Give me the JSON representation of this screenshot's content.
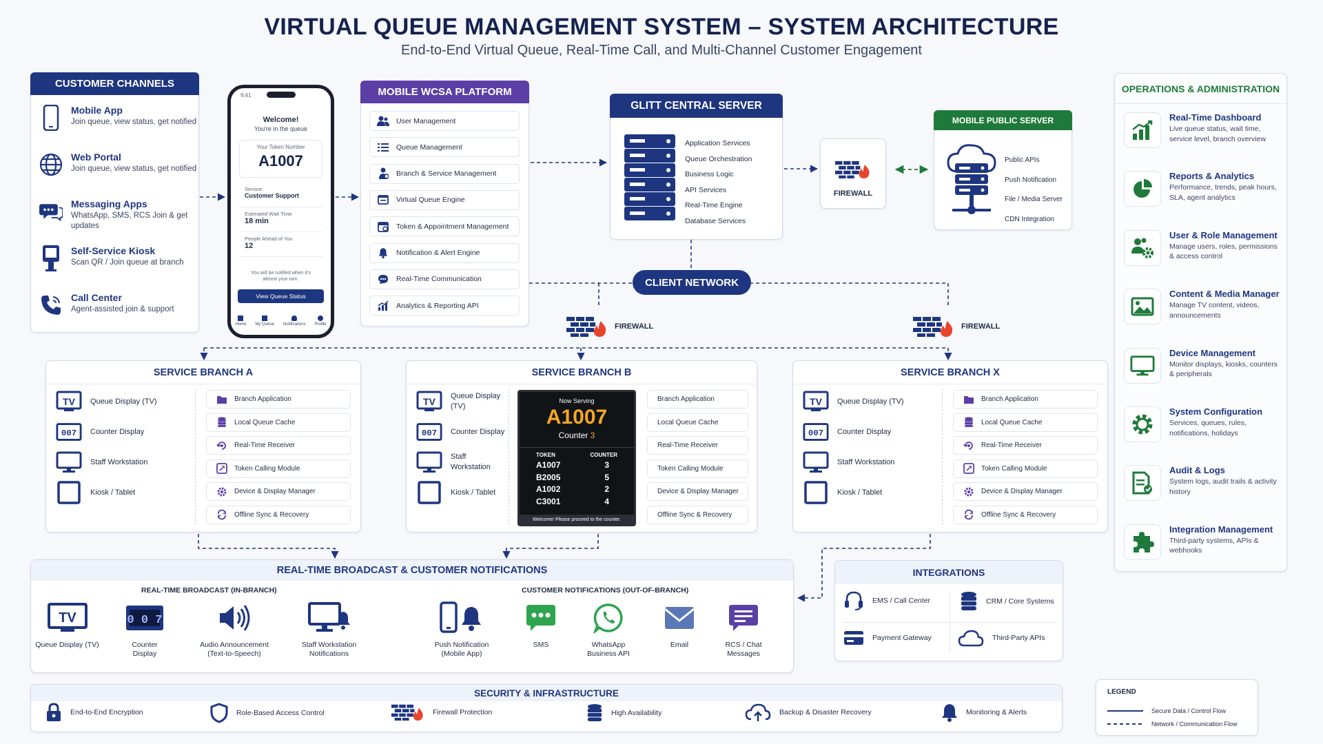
{
  "title": "VIRTUAL QUEUE MANAGEMENT SYSTEM – SYSTEM ARCHITECTURE",
  "subtitle": "End-to-End Virtual Queue, Real-Time Call, and Multi-Channel Customer Engagement",
  "colors": {
    "navy": "#1e3680",
    "purple": "#5b3fa6",
    "green": "#1e7a3a",
    "fire": "#e8452c"
  },
  "channels": {
    "header": "CUSTOMER CHANNELS",
    "items": [
      {
        "title": "Mobile App",
        "desc": "Join queue, view status, get notified",
        "icon": "mobile-icon"
      },
      {
        "title": "Web Portal",
        "desc": "Join queue, view status, get notified",
        "icon": "globe-icon"
      },
      {
        "title": "Messaging Apps",
        "desc": "WhatsApp, SMS, RCS Join & get updates",
        "icon": "chat-icon"
      },
      {
        "title": "Self-Service Kiosk",
        "desc": "Scan QR / Join queue at branch",
        "icon": "kiosk-icon"
      },
      {
        "title": "Call Center",
        "desc": "Agent-assisted join & support",
        "icon": "phone-icon"
      }
    ]
  },
  "phone": {
    "time": "9:41",
    "welcome": "Welcome!",
    "in_queue": "You're in the queue",
    "token_label": "Your Token Number",
    "token": "A1007",
    "service_label": "Service",
    "service": "Customer Support",
    "wait_label": "Estimated Wait Time",
    "wait": "18 min",
    "ahead_label": "People Ahead of You",
    "ahead": "12",
    "notify": "You will be notified when it's almost your turn.",
    "button": "View Queue Status",
    "nav": [
      "Home",
      "My Queue",
      "Notifications",
      "Profile"
    ]
  },
  "wcsa": {
    "header": "MOBILE WCSA PLATFORM",
    "modules": [
      "User Management",
      "Queue Management",
      "Branch & Service Management",
      "Virtual Queue Engine",
      "Token & Appointment Management",
      "Notification & Alert Engine",
      "Real-Time Communication",
      "Analytics & Reporting API"
    ]
  },
  "central": {
    "header": "GLITT CENTRAL SERVER",
    "services": [
      "Application Services",
      "Queue Orchestration",
      "Business Logic",
      "API Services",
      "Real-Time Engine",
      "Database Services"
    ]
  },
  "firewall_label": "FIREWALL",
  "public_server": {
    "header": "MOBILE PUBLIC SERVER",
    "items": [
      "Public APIs",
      "Push Notification",
      "File / Media Server",
      "CDN Integration"
    ]
  },
  "client_network": "CLIENT NETWORK",
  "branch_devices": [
    {
      "label": "Queue Display (TV)",
      "icon": "tv-icon"
    },
    {
      "label": "Counter Display",
      "icon": "counter-display-icon"
    },
    {
      "label": "Staff Workstation",
      "icon": "monitor-icon"
    },
    {
      "label": "Kiosk / Tablet",
      "icon": "tablet-icon"
    }
  ],
  "branch_modules": [
    "Branch Application",
    "Local Queue Cache",
    "Real-Time Receiver",
    "Token Calling Module",
    "Device & Display Manager",
    "Offline Sync & Recovery"
  ],
  "branches": [
    "SERVICE BRANCH A",
    "SERVICE BRANCH B",
    "SERVICE BRANCH X"
  ],
  "tv_text": "TV",
  "counter_text": "007",
  "counter_big": "0 0 7",
  "now_serving": {
    "label": "Now Serving",
    "token": "A1007",
    "counter_label": "Counter",
    "counter": "3",
    "col_token": "TOKEN",
    "col_counter": "COUNTER",
    "rows": [
      [
        "A1007",
        "3"
      ],
      [
        "B2005",
        "5"
      ],
      [
        "A1002",
        "2"
      ],
      [
        "C3001",
        "4"
      ]
    ],
    "footer": "Welcome! Please proceed to the counter."
  },
  "broadcast": {
    "header": "REAL-TIME BROADCAST & CUSTOMER NOTIFICATIONS",
    "in_branch": "REAL-TIME BROADCAST (IN-BRANCH)",
    "out_branch": "CUSTOMER NOTIFICATIONS (OUT-OF-BRANCH)",
    "in_items": [
      "Queue Display (TV)",
      "Counter Display",
      "Audio Announcement (Text-to-Speech)",
      "Staff Workstation Notifications"
    ],
    "out_items": [
      "Push Notification (Mobile App)",
      "SMS",
      "WhatsApp Business API",
      "Email",
      "RCS / Chat Messages"
    ]
  },
  "integrations": {
    "header": "INTEGRATIONS",
    "items": [
      "EMS / Call Center",
      "CRM / Core Systems",
      "Payment Gateway",
      "Third-Party APIs"
    ]
  },
  "operations": {
    "header": "OPERATIONS & ADMINISTRATION",
    "items": [
      {
        "title": "Real-Time Dashboard",
        "desc": "Live queue status, wait time, service level, branch overview",
        "icon": "chart-icon"
      },
      {
        "title": "Reports & Analytics",
        "desc": "Performance, trends, peak hours, SLA, agent analytics",
        "icon": "pie-icon"
      },
      {
        "title": "User & Role Management",
        "desc": "Manage users, roles, permissions & access control",
        "icon": "users-gear-icon"
      },
      {
        "title": "Content & Media Manager",
        "desc": "Manage TV content, videos, announcements",
        "icon": "image-icon"
      },
      {
        "title": "Device Management",
        "desc": "Monitor displays, kiosks, counters & peripherals",
        "icon": "monitor-icon"
      },
      {
        "title": "System Configuration",
        "desc": "Services, queues, rules, notifications, holidays",
        "icon": "gear-icon"
      },
      {
        "title": "Audit & Logs",
        "desc": "System logs, audit trails & activity history",
        "icon": "document-icon"
      },
      {
        "title": "Integration Management",
        "desc": "Third-party systems, APIs & webhooks",
        "icon": "puzzle-icon"
      }
    ]
  },
  "security": {
    "header": "SECURITY & INFRASTRUCTURE",
    "items": [
      "End-to-End Encryption",
      "Role-Based Access Control",
      "Firewall Protection",
      "High Availability",
      "Backup & Disaster Recovery",
      "Monitoring & Alerts"
    ]
  },
  "legend": {
    "title": "LEGEND",
    "solid": "Secure Data / Control Flow",
    "dashed": "Network / Communication Flow"
  }
}
